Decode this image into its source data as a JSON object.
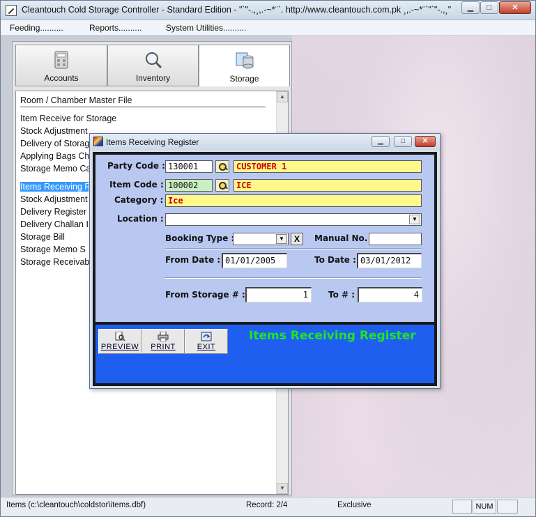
{
  "window": {
    "title": "Cleantouch Cold Storage Controller - Standard Edition  -  \"`\"-.,¸,.-~*¨`. http://www.cleantouch.com.pk ¸,.-~*¨`\"`\"-.,¸\"",
    "minimize": "▁",
    "maximize": "□",
    "close": "✕"
  },
  "menu": [
    "Feeding..........",
    "Reports..........",
    "System Utilities.........."
  ],
  "nav_tabs": [
    {
      "label": "Accounts",
      "icon": "calculator-icon"
    },
    {
      "label": "Inventory",
      "icon": "magnifier-icon"
    },
    {
      "label": "Storage",
      "icon": "storage-icon"
    }
  ],
  "list_items": [
    "Room / Chamber Master File",
    "Item Receive for Storage",
    "Stock Adjustment",
    "Delivery of Storage",
    "Applying Bags Ch",
    "Storage Memo Ca",
    "Items Receiving R",
    "Stock Adjustment",
    "Delivery Register",
    "Delivery Challan I",
    "Storage Bill",
    "Storage Memo S",
    "Storage Receivab"
  ],
  "dialog": {
    "title": "Items Receiving Register",
    "party_code_label": "Party Code :",
    "party_code": "130001",
    "party_name": "CUSTOMER 1",
    "item_code_label": "Item Code :",
    "item_code": "100002",
    "item_name": "ICE",
    "category_label": "Category :",
    "category": "Ice",
    "location_label": "Location :",
    "location": "",
    "booking_type_label": "Booking Type :",
    "booking_type": "",
    "clear_label": "X",
    "manual_no_label": "Manual No.",
    "manual_no": "",
    "from_date_label": "From Date :",
    "from_date": "01/01/2005",
    "to_date_label": "To Date :",
    "to_date": "03/01/2012",
    "from_storage_label": "From Storage # :",
    "from_storage": "1",
    "to_storage_label": "To # :",
    "to_storage": "4",
    "buttons": {
      "preview": "PREVIEW",
      "print": "PRINT",
      "exit": "EXIT"
    },
    "banner": "Items Receiving Register"
  },
  "status": {
    "file": "Items (c:\\cleantouch\\coldstor\\items.dbf)",
    "record": "Record: 2/4",
    "mode": "Exclusive",
    "num": "NUM"
  }
}
